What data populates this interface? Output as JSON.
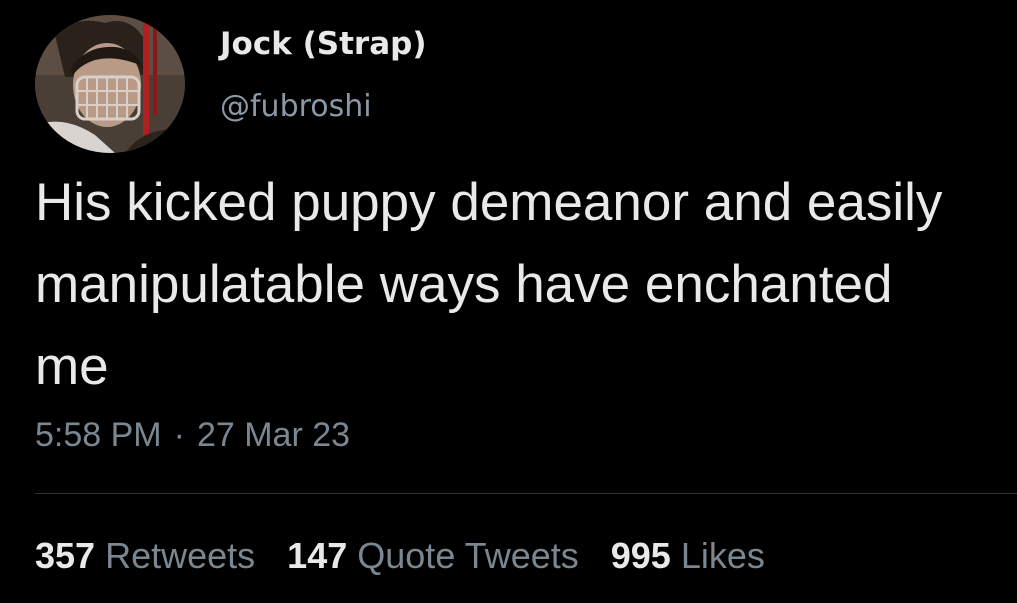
{
  "author": {
    "display_name": "Jock (Strap)",
    "handle": "@fubroshi",
    "avatar_icon": "profile-avatar"
  },
  "tweet": {
    "text": "His kicked puppy demeanor and easily manipulatable ways have enchanted me",
    "time": "5:58 PM",
    "separator": "·",
    "date": "27 Mar 23"
  },
  "stats": {
    "retweets": {
      "count": "357",
      "label": "Retweets"
    },
    "quote_tweets": {
      "count": "147",
      "label": "Quote Tweets"
    },
    "likes": {
      "count": "995",
      "label": "Likes"
    }
  },
  "colors": {
    "background": "#000000",
    "primary_text": "#e7e9ea",
    "secondary_text": "#7a8690",
    "divider": "#2f3336"
  }
}
